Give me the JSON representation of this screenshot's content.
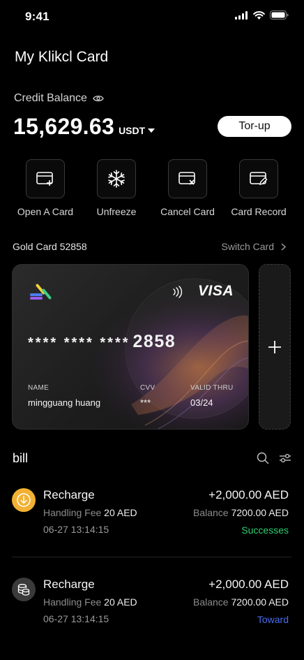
{
  "status": {
    "time": "9:41"
  },
  "header": {
    "title": "My Klikcl Card"
  },
  "balance": {
    "label": "Credit Balance",
    "amount": "15,629.63",
    "currency": "USDT",
    "topup_label": "Tor-up"
  },
  "actions": [
    {
      "label": "Open A Card",
      "icon": "add-card-icon"
    },
    {
      "label": "Unfreeze",
      "icon": "snowflake-icon"
    },
    {
      "label": "Cancel Card",
      "icon": "cancel-card-icon"
    },
    {
      "label": "Card Record",
      "icon": "card-record-icon"
    }
  ],
  "card_section": {
    "card_name": "Gold Card 52858",
    "switch_label": "Switch Card"
  },
  "card": {
    "number_masked": "**** **** ****",
    "number_last": "2858",
    "brand": "VISA",
    "name_label": "NAME",
    "name_value": "mingguang huang",
    "cvv_label": "CVV",
    "cvv_value": "***",
    "valid_label": "VALID THRU",
    "valid_value": "03/24"
  },
  "bill": {
    "title": "bill",
    "items": [
      {
        "type": "Recharge",
        "fee_label": "Handling Fee",
        "fee_value": "20 AED",
        "time": "06-27 13:14:15",
        "amount": "+2,000.00 AED",
        "balance_label": "Balance",
        "balance_value": "7200.00 AED",
        "status": "Successes",
        "status_color": "#2ecc71",
        "icon": "download-arrow-icon",
        "icon_color": "#f2b133"
      },
      {
        "type": "Recharge",
        "fee_label": "Handling Fee",
        "fee_value": "20 AED",
        "time": "06-27 13:14:15",
        "amount": "+2,000.00 AED",
        "balance_label": "Balance",
        "balance_value": "7200.00 AED",
        "status": "Toward",
        "status_color": "#4a6cf0",
        "icon": "coin-stack-icon",
        "icon_color": "#3a3a3a"
      }
    ]
  }
}
